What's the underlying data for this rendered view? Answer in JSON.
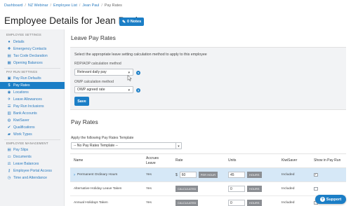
{
  "breadcrumb": {
    "items": [
      "Dashboard",
      "NZ Webinar",
      "Employee List",
      "Jean Paul"
    ],
    "current": "Pay Rates",
    "separator": "/"
  },
  "page_title": "Employee Details for Jean Paul",
  "notes_badge": {
    "label": "0 Notes",
    "icon": "note-icon"
  },
  "sidebar": {
    "sections": [
      {
        "title": "EMPLOYEE SETTINGS",
        "items": [
          {
            "label": "Details",
            "icon": "user-icon"
          },
          {
            "label": "Emergency Contacts",
            "icon": "plus-icon"
          },
          {
            "label": "Tax Code Declaration",
            "icon": "document-icon"
          },
          {
            "label": "Opening Balances",
            "icon": "calculator-icon"
          }
        ]
      },
      {
        "title": "PAY RUN SETTINGS",
        "items": [
          {
            "label": "Pay Run Defaults",
            "icon": "calendar-icon"
          },
          {
            "label": "Pay Rates",
            "icon": "dollar-icon",
            "active": true
          },
          {
            "label": "Locations",
            "icon": "globe-icon"
          },
          {
            "label": "Leave Allowances",
            "icon": "plane-icon"
          },
          {
            "label": "Pay Run Inclusions",
            "icon": "list-icon"
          },
          {
            "label": "Bank Accounts",
            "icon": "bank-icon"
          },
          {
            "label": "KiwiSaver",
            "icon": "piggy-icon"
          },
          {
            "label": "Qualifications",
            "icon": "certificate-icon"
          },
          {
            "label": "Work Types",
            "icon": "briefcase-icon"
          }
        ]
      },
      {
        "title": "EMPLOYEE MANAGEMENT",
        "items": [
          {
            "label": "Pay Slips",
            "icon": "file-icon"
          },
          {
            "label": "Documents",
            "icon": "folder-icon"
          },
          {
            "label": "Leave Balances",
            "icon": "balance-icon"
          },
          {
            "label": "Employee Portal Access",
            "icon": "key-icon"
          },
          {
            "label": "Time and Attendance",
            "icon": "clock-icon"
          }
        ]
      }
    ]
  },
  "leave_pay": {
    "heading": "Leave Pay Rates",
    "intro": "Select the appropriate leave setting calculation method to apply to this employee",
    "rdp_label": "RDP/AOP calculation method",
    "rdp_value": "Relevant daily pay",
    "owp_label": "OWP calculation method",
    "owp_value": "OWP agreed rate",
    "save_label": "Save"
  },
  "pay_rates": {
    "heading": "Pay Rates",
    "template_label": "Apply the following Pay Rates Template",
    "template_value": "-- No Pay Rates Template --",
    "columns": [
      "Name",
      "Accrues Leave",
      "Rate",
      "Units",
      "KiwiSaver",
      "Show in Pay Run"
    ],
    "rows": [
      {
        "name": "Permanent Ordinary Hours",
        "accrues": "Yes",
        "currency": "$",
        "rate": "60",
        "rate_unit": "PER HOUR",
        "units": "45",
        "units_unit": "HOURS",
        "kiwisaver": "Included",
        "show": true,
        "highlight": true
      },
      {
        "name": "Alternative Holiday Leave Taken",
        "accrues": "Yes",
        "rate_calc": "CALCULATED",
        "units": "0",
        "units_unit": "HOURS",
        "kiwisaver": "Included",
        "show": false
      },
      {
        "name": "Annual Holidays Taken",
        "accrues": "Yes",
        "rate_calc": "CALCULATED",
        "units": "0",
        "units_unit": "HOURS",
        "kiwisaver": "Included",
        "show": false
      }
    ]
  },
  "support": {
    "label": "Support",
    "icon": "question-icon"
  },
  "colors": {
    "accent": "#1b7ec6",
    "sidebar_bg": "#f1f2f4",
    "row_highlight": "#d6e8f7"
  }
}
